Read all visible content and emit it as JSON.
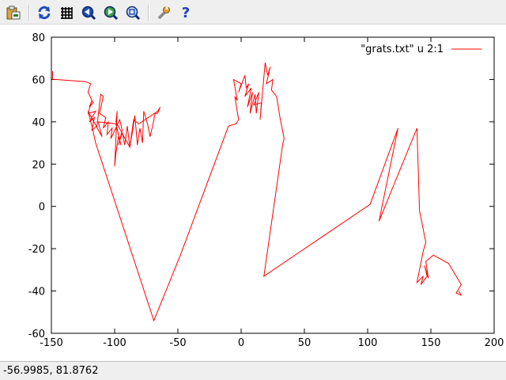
{
  "toolbar": {
    "buttons": [
      {
        "name": "export-button",
        "icon": "clipboard-export-icon"
      },
      {
        "name": "replot-button",
        "icon": "refresh-icon"
      },
      {
        "name": "grid-button",
        "icon": "grid-icon"
      },
      {
        "name": "previous-zoom-button",
        "icon": "zoom-previous-icon"
      },
      {
        "name": "next-zoom-button",
        "icon": "zoom-next-icon"
      },
      {
        "name": "autoscale-button",
        "icon": "autoscale-icon"
      },
      {
        "name": "options-button",
        "icon": "wrench-icon"
      },
      {
        "name": "help-button",
        "icon": "help-icon",
        "label": "?"
      }
    ]
  },
  "status": {
    "coordinates": "-56.9985,  81.8762"
  },
  "colors": {
    "series": "#ff0000",
    "axis": "#000000",
    "help": "#1f3fbf"
  },
  "chart_data": {
    "type": "line",
    "title": "",
    "xlabel": "",
    "ylabel": "",
    "xlim": [
      -150,
      200
    ],
    "ylim": [
      -60,
      80
    ],
    "xticks": [
      -150,
      -100,
      -50,
      0,
      50,
      100,
      150,
      200
    ],
    "yticks": [
      -60,
      -40,
      -20,
      0,
      20,
      40,
      60,
      80
    ],
    "xtick_labels": [
      "-150",
      "-100",
      "-50",
      "0",
      "50",
      "100",
      "150",
      "200"
    ],
    "ytick_labels": [
      "-60",
      "-40",
      "-20",
      "0",
      "20",
      "40",
      "60",
      "80"
    ],
    "grid": false,
    "legend_position": "top-right",
    "series": [
      {
        "name": "\"grats.txt\" u 2:1",
        "points": [
          [
            -149,
            64
          ],
          [
            -149,
            60
          ],
          [
            -147,
            60
          ],
          [
            -123,
            59
          ],
          [
            -119,
            58
          ],
          [
            -121,
            54
          ],
          [
            -117,
            49
          ],
          [
            -120,
            47
          ],
          [
            -118,
            50
          ],
          [
            -121,
            44
          ],
          [
            -115,
            45
          ],
          [
            -120,
            40
          ],
          [
            -116,
            42
          ],
          [
            -118,
            36
          ],
          [
            -114,
            38
          ],
          [
            -111,
            53
          ],
          [
            -109,
            52
          ],
          [
            -112,
            44
          ],
          [
            -107,
            42
          ],
          [
            -109,
            37
          ],
          [
            -105,
            40
          ],
          [
            -106,
            34
          ],
          [
            -102,
            37
          ],
          [
            -103,
            32
          ],
          [
            -96,
            41
          ],
          [
            -94,
            36
          ],
          [
            -97,
            29
          ],
          [
            -94,
            35
          ],
          [
            -92,
            29
          ],
          [
            -90,
            38
          ],
          [
            -88,
            28
          ],
          [
            -86,
            35
          ],
          [
            -84,
            43
          ],
          [
            -82,
            29
          ],
          [
            -80,
            37
          ],
          [
            -78,
            30
          ],
          [
            -77,
            45
          ],
          [
            -74,
            39
          ],
          [
            -72,
            33
          ],
          [
            -70,
            38
          ],
          [
            -68,
            44
          ],
          [
            -66,
            44
          ],
          [
            -64,
            47
          ],
          [
            -66,
            45
          ],
          [
            -81,
            39
          ],
          [
            -85,
            41
          ],
          [
            -88,
            28
          ],
          [
            -99,
            40
          ],
          [
            -98,
            45
          ],
          [
            -100,
            19
          ],
          [
            -99,
            25
          ],
          [
            -97,
            33
          ],
          [
            -95,
            29
          ],
          [
            -99,
            39
          ],
          [
            -113,
            40
          ],
          [
            -110,
            33
          ],
          [
            -121,
            45
          ],
          [
            -118,
            38
          ],
          [
            -115,
            30
          ],
          [
            -69,
            -54
          ],
          [
            -48,
            -23
          ],
          [
            -10,
            38
          ],
          [
            -4,
            39
          ],
          [
            -2,
            41
          ],
          [
            -5,
            52
          ],
          [
            -3,
            50
          ],
          [
            -6,
            60
          ],
          [
            0,
            58
          ],
          [
            -2,
            54
          ],
          [
            3,
            62
          ],
          [
            4,
            56
          ],
          [
            6,
            58
          ],
          [
            3,
            52
          ],
          [
            8,
            56
          ],
          [
            5,
            47
          ],
          [
            9,
            54
          ],
          [
            7,
            44
          ],
          [
            11,
            53
          ],
          [
            12,
            44
          ],
          [
            14,
            54
          ],
          [
            10,
            48
          ],
          [
            16,
            49
          ],
          [
            15,
            41
          ],
          [
            19,
            68
          ],
          [
            21,
            62
          ],
          [
            23,
            66
          ],
          [
            20,
            58
          ],
          [
            25,
            60
          ],
          [
            24,
            55
          ],
          [
            28,
            52
          ],
          [
            31,
            41
          ],
          [
            34,
            32
          ],
          [
            33,
            30
          ],
          [
            18,
            -33
          ],
          [
            102,
            1
          ],
          [
            124,
            37
          ],
          [
            109,
            -7
          ],
          [
            139,
            37
          ],
          [
            141,
            -2
          ],
          [
            146,
            -17
          ],
          [
            144,
            -21
          ],
          [
            140,
            -33
          ],
          [
            139,
            -36
          ],
          [
            144,
            -33
          ],
          [
            142,
            -37
          ],
          [
            147,
            -33
          ],
          [
            145,
            -28
          ],
          [
            148,
            -34
          ],
          [
            146,
            -26
          ],
          [
            152,
            -23
          ],
          [
            164,
            -27
          ],
          [
            174,
            -37
          ],
          [
            170,
            -41
          ],
          [
            174,
            -42
          ],
          [
            172,
            -40
          ]
        ]
      }
    ]
  }
}
